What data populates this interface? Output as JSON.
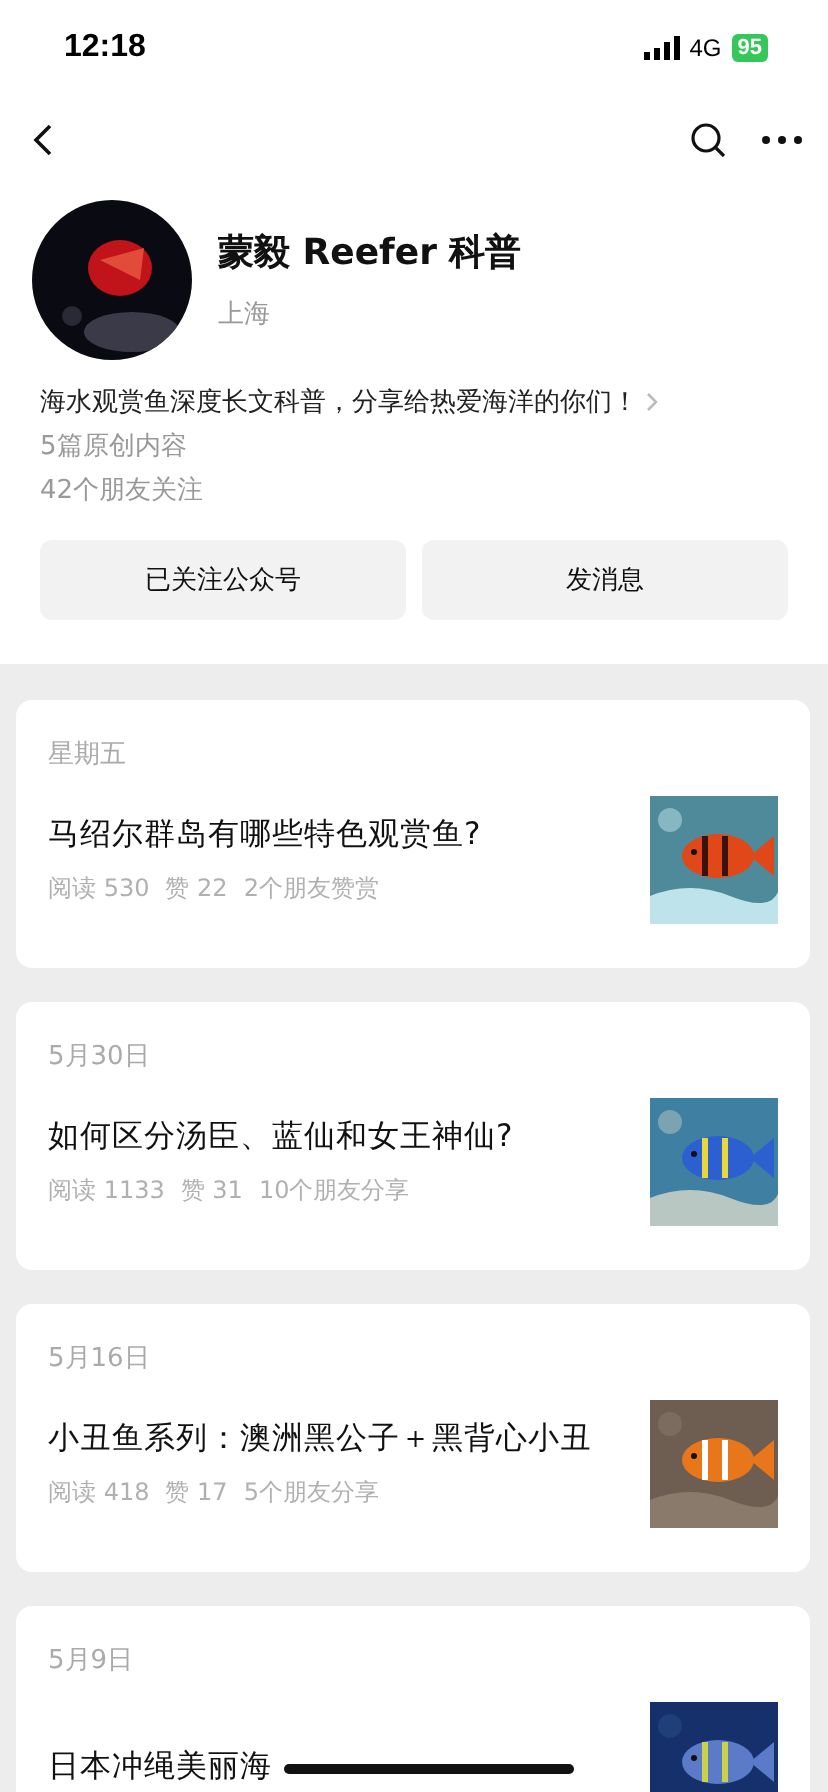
{
  "status_bar": {
    "time": "12:18",
    "network": "4G",
    "battery": "95"
  },
  "profile": {
    "name": "蒙毅 Reefer 科普",
    "location": "上海",
    "description": "海水观赏鱼深度长文科普，分享给热爱海洋的你们！",
    "original_count": "5篇原创内容",
    "friends_following": "42个朋友关注"
  },
  "buttons": [
    {
      "label": "已关注公众号"
    },
    {
      "label": "发消息"
    }
  ],
  "articles": [
    {
      "date": "星期五",
      "title": "马绍尔群岛有哪些特色观赏鱼?",
      "reads": "阅读 530",
      "likes": "赞 22",
      "friends": "2个朋友赞赏"
    },
    {
      "date": "5月30日",
      "title": "如何区分汤臣、蓝仙和女王神仙?",
      "reads": "阅读 1133",
      "likes": "赞 31",
      "friends": "10个朋友分享"
    },
    {
      "date": "5月16日",
      "title": "小丑鱼系列：澳洲黑公子＋黑背心小丑",
      "reads": "阅读 418",
      "likes": "赞 17",
      "friends": "5个朋友分享"
    },
    {
      "date": "5月9日",
      "title": "日本冲绳美丽海"
    }
  ]
}
